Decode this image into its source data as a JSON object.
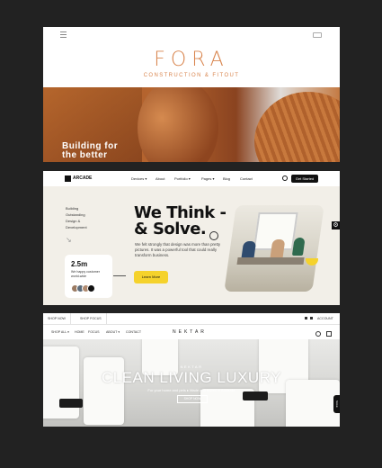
{
  "fora": {
    "brand": "FORA",
    "tagline": "CONSTRUCTION & FITOUT",
    "hero_line1": "Building for",
    "hero_line2": "the better",
    "accent": "#d9864f"
  },
  "arcade": {
    "logo_text": "ARCADE",
    "nav": [
      "Devices ▾",
      "About",
      "Portfolio ▾",
      "Pages ▾",
      "Blog",
      "Contact"
    ],
    "cta": "Get Started",
    "side_links": [
      "Building",
      "Outstanding",
      "Design &",
      "Development"
    ],
    "headline_1": "We Think -",
    "headline_2": "& Solve.",
    "paragraph": "We felt strongly that design was more than pretty pictures. It was a powerful tool that could really transform business.",
    "learn_more": "Learn More",
    "stat_value": "2.5m",
    "stat_text": "We happy customer world-wide",
    "accent": "#f5d22c"
  },
  "nektar": {
    "top_buttons": [
      "SHOP NOW",
      "SHOP FOCUS"
    ],
    "account": "ACCOUNT",
    "nav": [
      "SHOP ALL ▾",
      "HOME",
      "FOCUS",
      "ABOUT ▾",
      "CONTACT"
    ],
    "logo": "NEKTAR",
    "eyebrow": "NEKTAR",
    "headline": "CLEAN LIVING LUXURY",
    "subline": "For your home and pets ▸ Made and tested in Australia",
    "button": "SHOP NOW",
    "side_tab": "SALE"
  }
}
